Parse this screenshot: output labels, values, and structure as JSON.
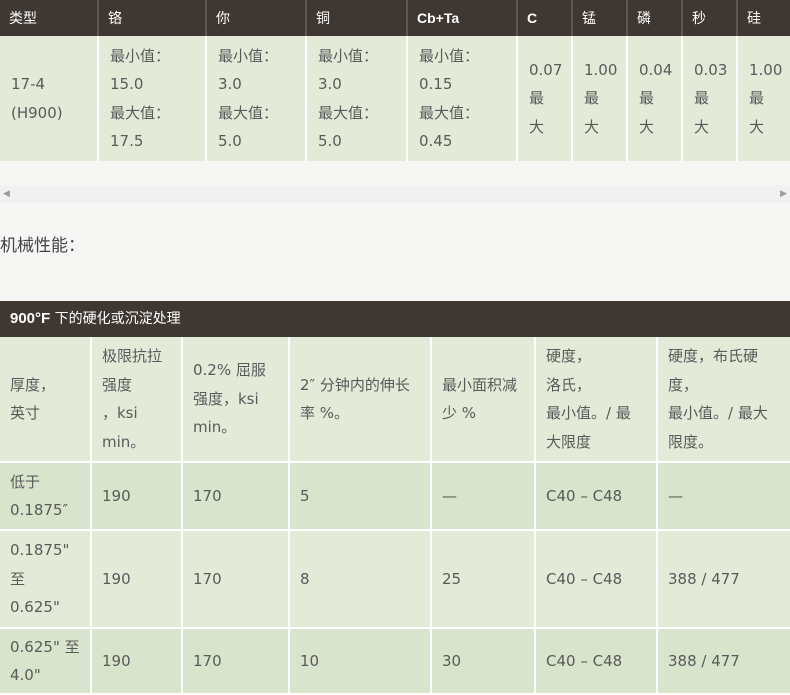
{
  "composition": {
    "headers": [
      "类型",
      "铬",
      "你",
      "铜",
      "Cb+Ta",
      "C",
      "锰",
      "磷",
      "秒",
      "硅"
    ],
    "row": {
      "type": [
        "17-4",
        "(H900)"
      ],
      "chromium": [
        "最小值：",
        "15.0",
        "最大值：",
        "17.5"
      ],
      "nickel": [
        "最小值：",
        "3.0",
        "最大值：",
        "5.0"
      ],
      "copper": [
        "最小值：",
        "3.0",
        "最大值：",
        "5.0"
      ],
      "cbta": [
        "最小值：",
        "0.15",
        "最大值：",
        "0.45"
      ],
      "c": [
        "0.07",
        "最",
        "大"
      ],
      "mn": [
        "1.00",
        "最",
        "大"
      ],
      "p": [
        "0.04",
        "最",
        "大"
      ],
      "s": [
        "0.03",
        "最",
        "大"
      ],
      "si": [
        "1.00",
        "最",
        "大"
      ]
    }
  },
  "scrollbar": {
    "left_arrow": "◀",
    "right_arrow": "▶"
  },
  "mechanical": {
    "title": "机械性能：",
    "caption_bold": "900°F",
    "caption_rest": " 下的硬化或沉淀处理",
    "headers": [
      [
        "厚度，",
        "英寸"
      ],
      [
        "极限抗拉",
        "强度",
        "，ksi",
        "min。"
      ],
      [
        "0.2% 屈服",
        "强度，ksi",
        "min。"
      ],
      [
        "2″ 分钟内的伸长",
        "率 %。"
      ],
      [
        "最小面积减",
        "少 %"
      ],
      [
        "硬度，",
        "洛氏，",
        "最小值。/ 最",
        "大限度"
      ],
      [
        "硬度，布氏硬",
        "度，",
        "最小值。/ 最大",
        "限度。"
      ]
    ],
    "rows": [
      {
        "thickness": [
          "低于",
          "0.1875″"
        ],
        "uts": "190",
        "ys": "170",
        "elong": "5",
        "ra": "—",
        "rockwell": "C40 – C48",
        "brinell": "—"
      },
      {
        "thickness": [
          "0.1875\"",
          "至",
          "0.625\""
        ],
        "uts": "190",
        "ys": "170",
        "elong": "8",
        "ra": "25",
        "rockwell": "C40 – C48",
        "brinell": "388 / 477"
      },
      {
        "thickness": [
          "0.625\" 至",
          "4.0\""
        ],
        "uts": "190",
        "ys": "170",
        "elong": "10",
        "ra": "30",
        "rockwell": "C40 – C48",
        "brinell": "388 / 477"
      }
    ]
  }
}
